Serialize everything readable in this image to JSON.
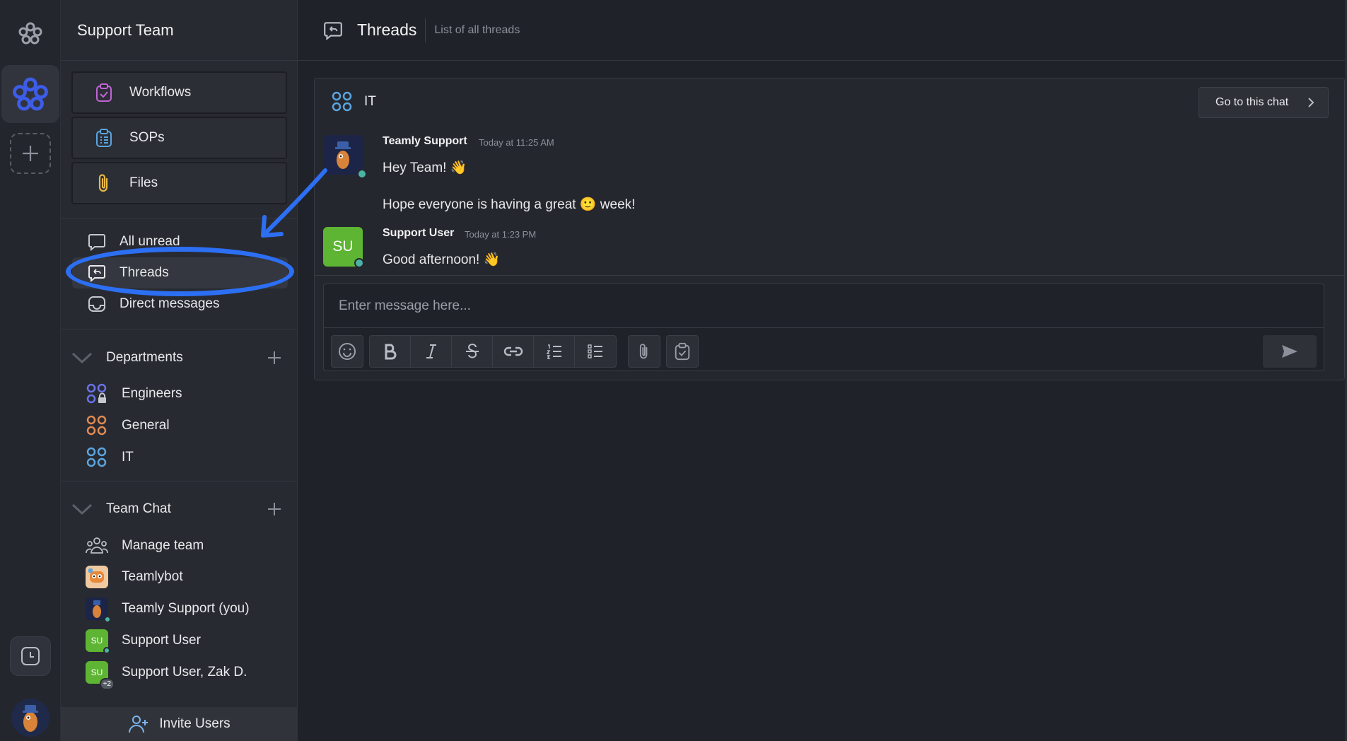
{
  "sidebar": {
    "team_name": "Support Team",
    "buttons": [
      {
        "label": "Workflows",
        "icon": "workflow-clipboard-icon"
      },
      {
        "label": "SOPs",
        "icon": "sop-list-icon"
      },
      {
        "label": "Files",
        "icon": "paperclip-icon"
      }
    ],
    "nav": [
      {
        "label": "All unread",
        "icon": "chat-bubble-icon"
      },
      {
        "label": "Threads",
        "icon": "threads-icon",
        "active": true
      },
      {
        "label": "Direct messages",
        "icon": "inbox-icon"
      }
    ],
    "departments": {
      "title": "Departments",
      "items": [
        {
          "label": "Engineers",
          "color": "#6a73e6"
        },
        {
          "label": "General",
          "color": "#e08a4f"
        },
        {
          "label": "IT",
          "color": "#5aa5e0"
        }
      ]
    },
    "team_chat": {
      "title": "Team Chat",
      "items": [
        {
          "label": "Manage team"
        },
        {
          "label": "Teamlybot"
        },
        {
          "label": "Teamly Support (you)"
        },
        {
          "label": "Support User",
          "avatar_text": "SU"
        },
        {
          "label": "Support User, Zak D.",
          "avatar_text": "SU",
          "badge": "+2"
        }
      ]
    },
    "invite_label": "Invite Users"
  },
  "main": {
    "title": "Threads",
    "subtitle": "List of all threads",
    "thread": {
      "channel": "IT",
      "goto_label": "Go to this chat",
      "messages": [
        {
          "author": "Teamly Support",
          "time": "Today at 11:25 AM",
          "lines": [
            "Hey Team! 👋",
            "Hope everyone is having a great 🙂 week!"
          ]
        },
        {
          "author": "Support User",
          "avatar_text": "SU",
          "time": "Today at 1:23 PM",
          "lines": [
            "Good afternoon! 👋"
          ]
        }
      ],
      "composer_placeholder": "Enter message here..."
    }
  },
  "colors": {
    "accent_blue": "#2c6ff3",
    "brand_blue": "#3d5ce8",
    "online": "#4bb3a6",
    "su_green": "#5db533"
  }
}
